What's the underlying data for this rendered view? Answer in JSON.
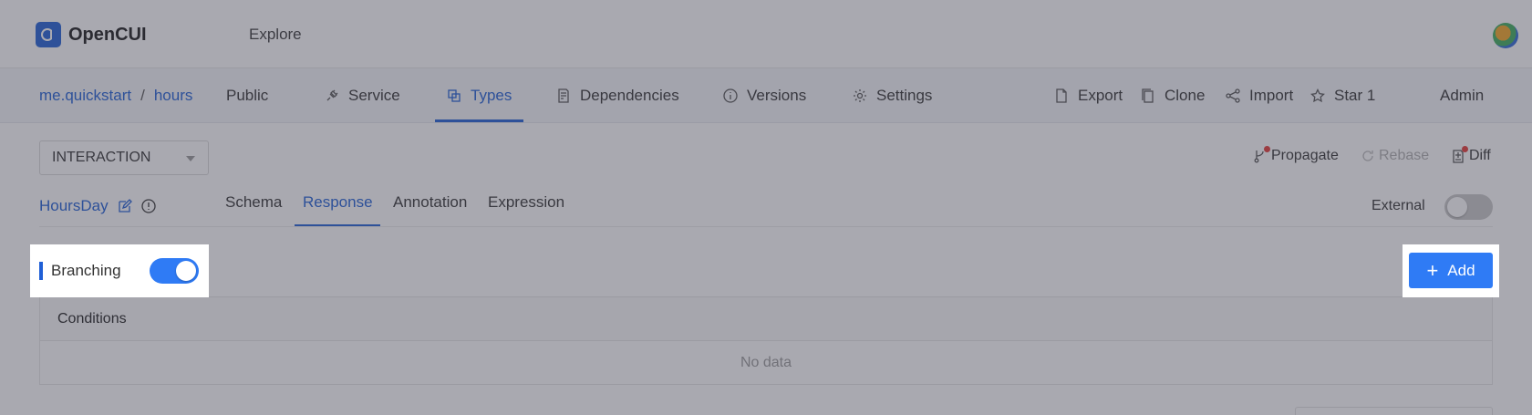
{
  "app": {
    "logo_text": "OpenCUI"
  },
  "topnav": {
    "explore_label": "Explore"
  },
  "breadcrumb": {
    "org": "me.quickstart",
    "separator": "/",
    "project": "hours"
  },
  "projbar": {
    "visibility": "Public",
    "tabs": [
      {
        "label": "Service",
        "icon": "plug-icon"
      },
      {
        "label": "Types",
        "icon": "types-icon",
        "active": true
      },
      {
        "label": "Dependencies",
        "icon": "document-icon"
      },
      {
        "label": "Versions",
        "icon": "info-icon"
      },
      {
        "label": "Settings",
        "icon": "gear-icon"
      }
    ],
    "actions": [
      {
        "label": "Export",
        "icon": "file-icon"
      },
      {
        "label": "Clone",
        "icon": "copy-icon"
      },
      {
        "label": "Import",
        "icon": "share-icon"
      },
      {
        "label": "Star 1",
        "icon": "star-icon"
      }
    ],
    "admin_label": "Admin"
  },
  "content": {
    "select_value": "INTERACTION",
    "toolbar": {
      "propagate_label": "Propagate",
      "rebase_label": "Rebase",
      "diff_label": "Diff"
    },
    "type_name": "HoursDay",
    "subtabs": [
      "Schema",
      "Response",
      "Annotation",
      "Expression"
    ],
    "active_subtab": "Response",
    "external_label": "External",
    "external_on": false,
    "branching_label": "Branching",
    "branching_on": true,
    "add_label": "Add",
    "table": {
      "columns": [
        "Conditions"
      ],
      "empty_text": "No data"
    }
  },
  "colors": {
    "accent": "#1f5fd6",
    "button": "#2f7bf5",
    "overlay": "rgba(64,64,80,0.45)"
  }
}
